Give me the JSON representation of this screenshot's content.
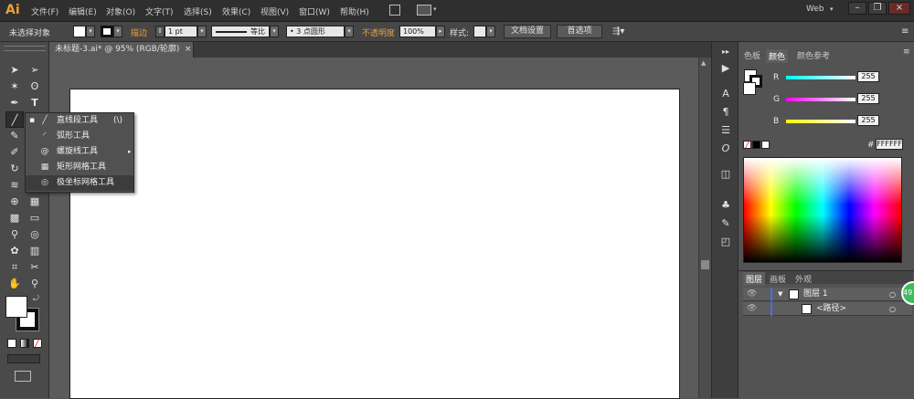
{
  "app": {
    "logo": "Ai",
    "workspace": "Web",
    "brand_color": "#f0a030"
  },
  "menu": [
    {
      "label": "文件(F)"
    },
    {
      "label": "编辑(E)"
    },
    {
      "label": "对象(O)"
    },
    {
      "label": "文字(T)"
    },
    {
      "label": "选择(S)"
    },
    {
      "label": "效果(C)"
    },
    {
      "label": "视图(V)"
    },
    {
      "label": "窗口(W)"
    },
    {
      "label": "帮助(H)"
    }
  ],
  "control_bar": {
    "selection_status": "未选择对象",
    "stroke_label": "描边",
    "stroke_weight": "1 pt",
    "profile_label": "等比",
    "brush_value": "3 点圆形",
    "opacity_label": "不透明度",
    "opacity_value": "100%",
    "style_label": "样式:",
    "doc_setup_button": "文档设置",
    "preferences_button": "首选项"
  },
  "document_tab": {
    "title": "未标题-3.ai* @ 95% (RGB/轮廓)",
    "close": "×"
  },
  "tool_flyout": {
    "items": [
      {
        "icon": "line-segment-icon",
        "label": "直线段工具",
        "shortcut": "(\\)"
      },
      {
        "icon": "arc-icon",
        "label": "弧形工具",
        "shortcut": ""
      },
      {
        "icon": "spiral-icon",
        "label": "螺旋线工具",
        "shortcut": ""
      },
      {
        "icon": "rectangular-grid-icon",
        "label": "矩形网格工具",
        "shortcut": ""
      },
      {
        "icon": "polar-grid-icon",
        "label": "极坐标网格工具",
        "shortcut": ""
      }
    ]
  },
  "color_panel": {
    "tabs": [
      "色板",
      "颜色",
      "颜色参考"
    ],
    "active_tab": "颜色",
    "channels": [
      {
        "label": "R",
        "value": "255"
      },
      {
        "label": "G",
        "value": "255"
      },
      {
        "label": "B",
        "value": "255"
      }
    ],
    "hash": "#",
    "hex": "FFFFFF"
  },
  "layers_panel": {
    "tabs": [
      "图层",
      "画板",
      "外观"
    ],
    "layers": [
      {
        "name": "图层 1"
      },
      {
        "name": "<路径>"
      }
    ]
  },
  "badge": {
    "value": "49"
  }
}
